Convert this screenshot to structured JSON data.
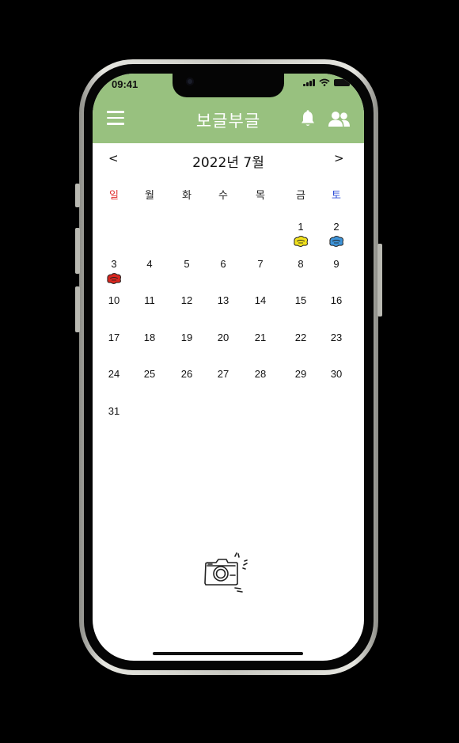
{
  "status_bar": {
    "time": "09:41"
  },
  "header": {
    "title": "보글부글",
    "background_color": "#98c17f"
  },
  "icons": {
    "menu": "menu-icon",
    "bell": "bell-icon",
    "friends": "people-icon",
    "camera": "camera-icon"
  },
  "calendar": {
    "prev_label": "<",
    "next_label": ">",
    "month_title": "2022년 7월",
    "weekdays": [
      "일",
      "월",
      "화",
      "수",
      "목",
      "금",
      "토"
    ],
    "weekday_colors": {
      "sunday": "#e03131",
      "saturday": "#2f4fd8",
      "default": "#222222"
    },
    "days": [
      "",
      "",
      "",
      "",
      "",
      "1",
      "2",
      "3",
      "4",
      "5",
      "6",
      "7",
      "8",
      "9",
      "10",
      "11",
      "12",
      "13",
      "14",
      "15",
      "16",
      "17",
      "18",
      "19",
      "20",
      "21",
      "22",
      "23",
      "24",
      "25",
      "26",
      "27",
      "28",
      "29",
      "30",
      "31"
    ],
    "stickers": [
      {
        "day": "1",
        "color": "#f2e21c"
      },
      {
        "day": "2",
        "color": "#3e94d9"
      },
      {
        "day": "3",
        "color": "#d9271f"
      }
    ]
  }
}
